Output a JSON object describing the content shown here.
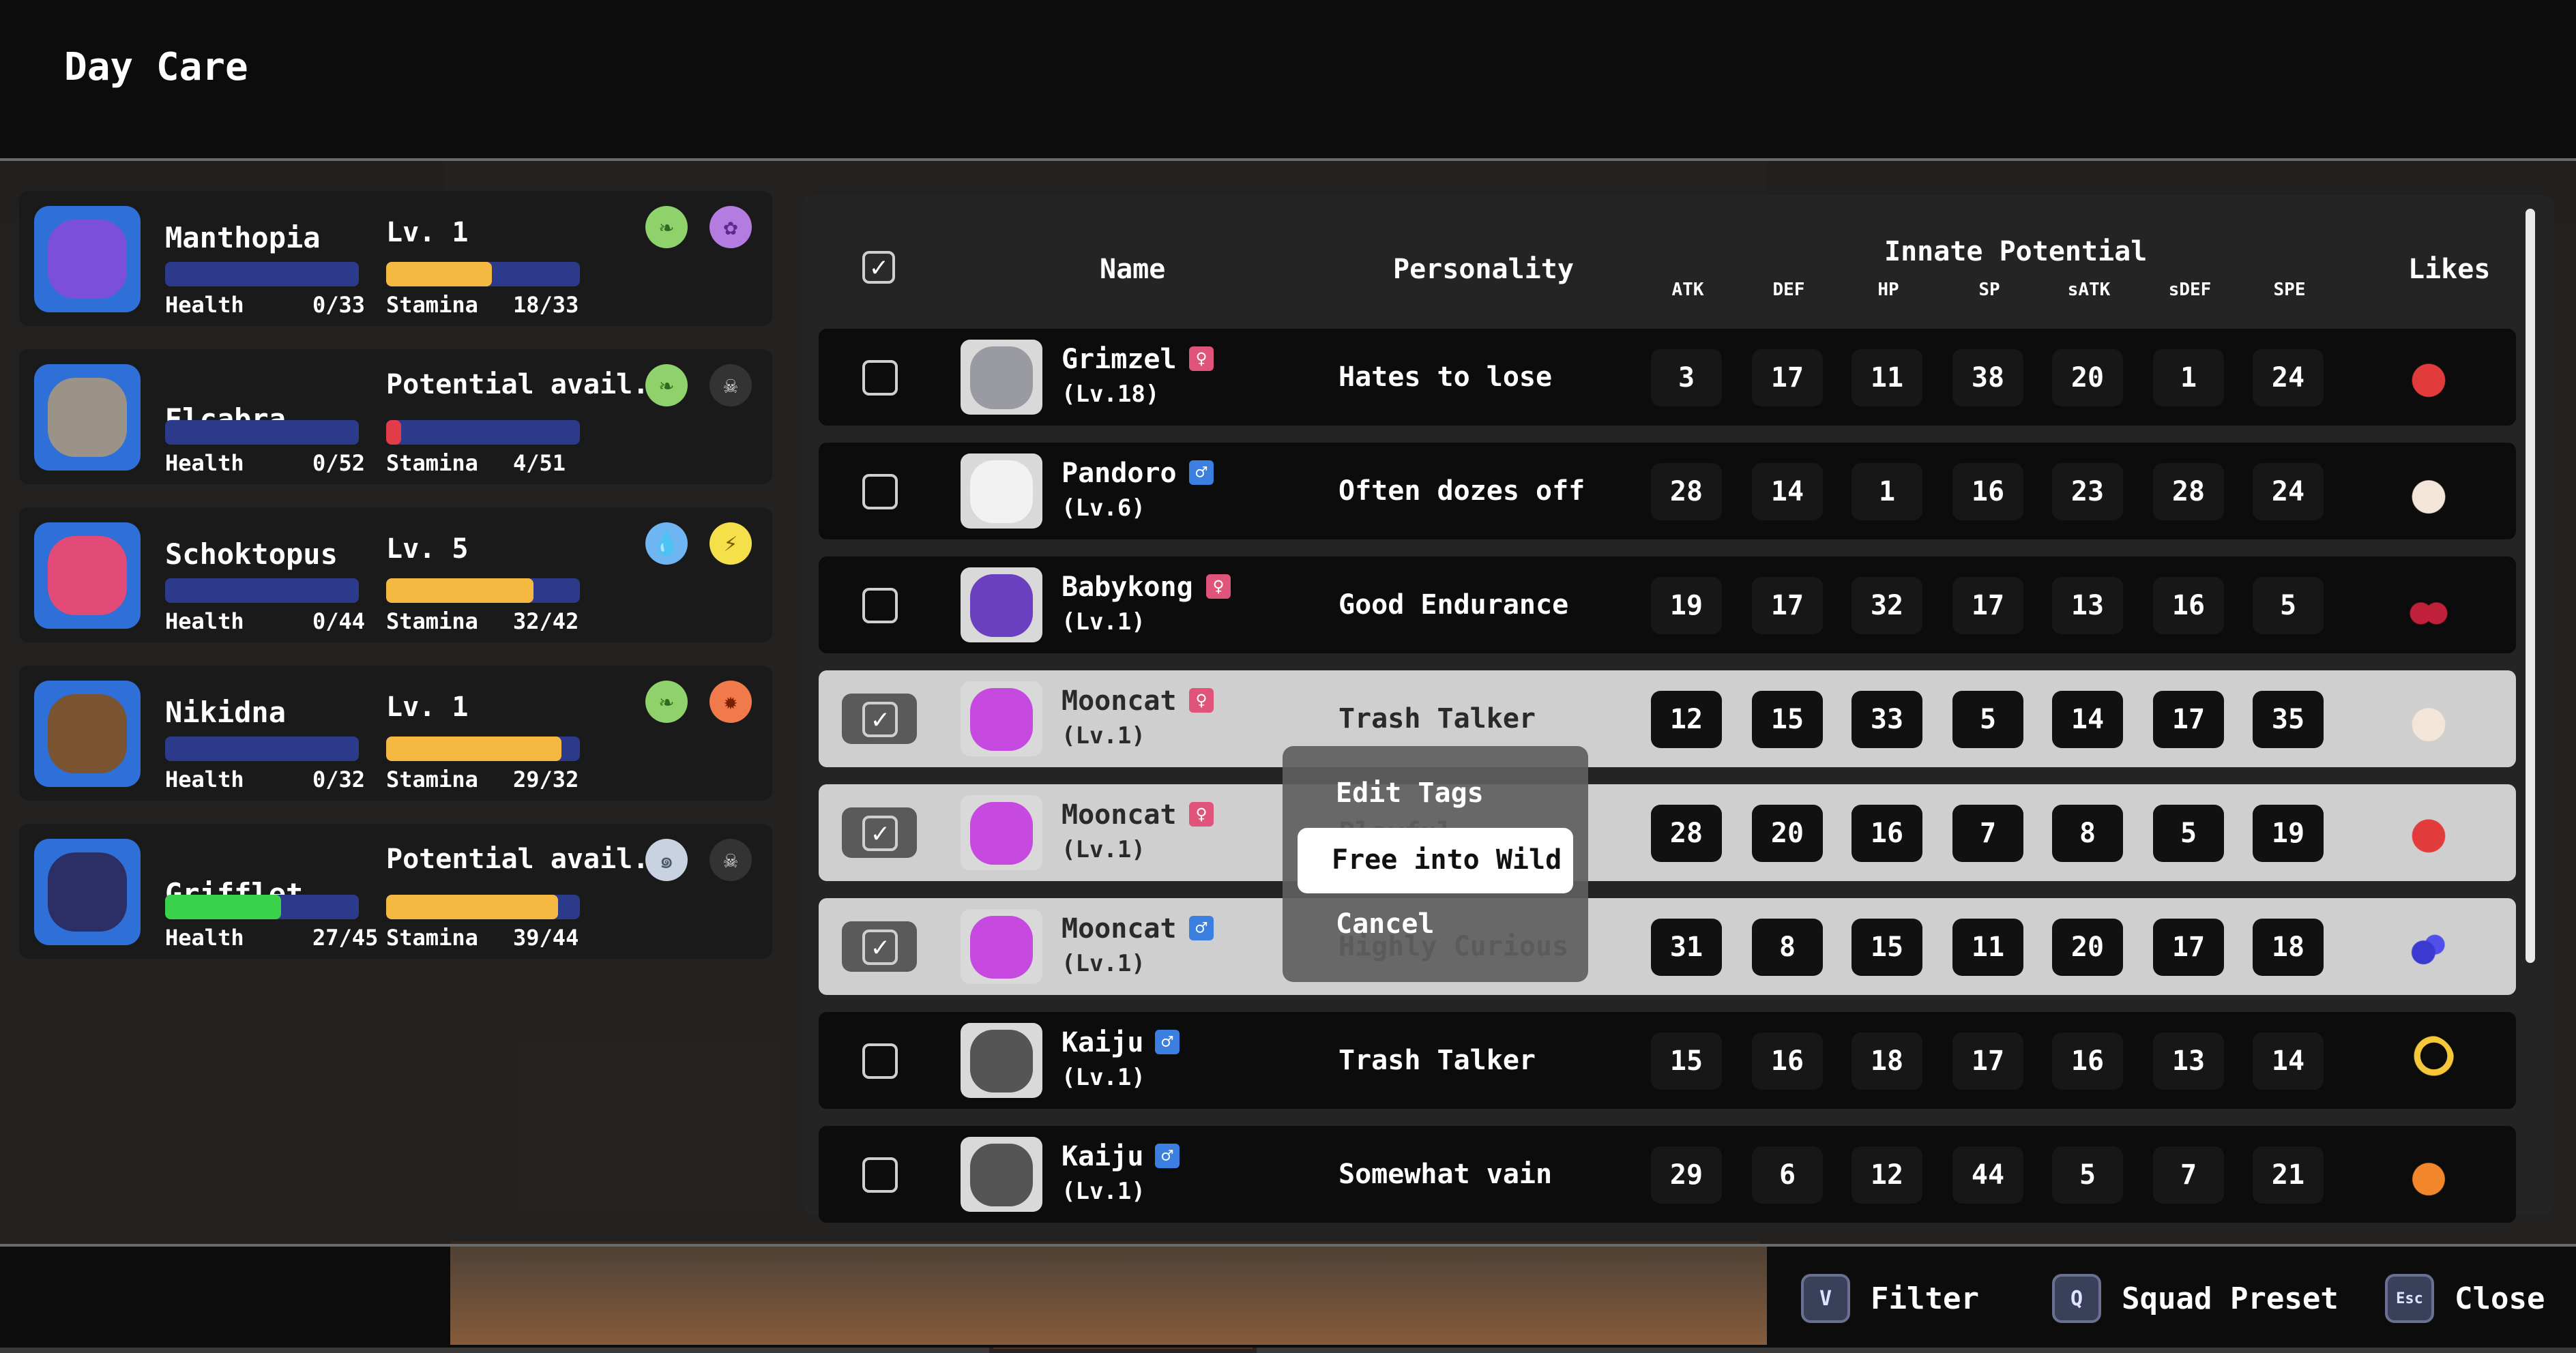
{
  "window": {
    "title": "Day Care"
  },
  "party": [
    {
      "name": "Manthopia",
      "level_label": "Lv. 1",
      "potential_label": "",
      "health_label": "Health",
      "health_value": "0/33",
      "health_fraction": 0.0,
      "stamina_label": "Stamina",
      "stamina_value": "18/33",
      "stamina_fraction": 0.545,
      "types": [
        "leaf-icon",
        "poison-icon"
      ],
      "color": "#7b4fd8"
    },
    {
      "name": "Elcabra",
      "level_label": "",
      "potential_label": "Potential avail.",
      "health_label": "Health",
      "health_value": "0/52",
      "health_fraction": 0.0,
      "stamina_label": "Stamina",
      "stamina_value": "4/51",
      "stamina_fraction": 0.078,
      "types": [
        "leaf-icon",
        "skull-icon"
      ],
      "color": "#9b9388"
    },
    {
      "name": "Schoktopus",
      "level_label": "Lv. 5",
      "potential_label": "",
      "health_label": "Health",
      "health_value": "0/44",
      "health_fraction": 0.0,
      "stamina_label": "Stamina",
      "stamina_value": "32/42",
      "stamina_fraction": 0.762,
      "types": [
        "water-icon",
        "lightning-icon"
      ],
      "color": "#e24a78"
    },
    {
      "name": "Nikidna",
      "level_label": "Lv. 1",
      "potential_label": "",
      "health_label": "Health",
      "health_value": "0/32",
      "health_fraction": 0.0,
      "stamina_label": "Stamina",
      "stamina_value": "29/32",
      "stamina_fraction": 0.906,
      "types": [
        "leaf-icon",
        "fire-icon"
      ],
      "color": "#7a5430"
    },
    {
      "name": "Grifflet",
      "level_label": "",
      "potential_label": "Potential avail.",
      "health_label": "Health",
      "health_value": "27/45",
      "health_fraction": 0.6,
      "stamina_label": "Stamina",
      "stamina_value": "39/44",
      "stamina_fraction": 0.886,
      "types": [
        "wind-icon",
        "skull-icon"
      ],
      "color": "#2b2f66"
    }
  ],
  "table": {
    "headers": {
      "name": "Name",
      "personality": "Personality",
      "potential": "Innate Potential",
      "likes": "Likes"
    },
    "stat_headers": [
      "ATK",
      "DEF",
      "HP",
      "SP",
      "sATK",
      "sDEF",
      "SPE"
    ],
    "select_all_checked": true,
    "rows": [
      {
        "name": "Grimzel",
        "level": "(Lv.18)",
        "gender": "female",
        "gender_symbol": "♀",
        "personality": "Hates to lose",
        "stats": [
          "3",
          "17",
          "11",
          "38",
          "20",
          "1",
          "24"
        ],
        "like": "strawberry-icon",
        "checked": false,
        "color": "#9a9aa2"
      },
      {
        "name": "Pandoro",
        "level": "(Lv.6)",
        "gender": "male",
        "gender_symbol": "♂",
        "personality": "Often dozes off",
        "stats": [
          "28",
          "14",
          "1",
          "16",
          "23",
          "28",
          "24"
        ],
        "like": "garlic-icon",
        "checked": false,
        "color": "#f2f2f2"
      },
      {
        "name": "Babykong",
        "level": "(Lv.1)",
        "gender": "female",
        "gender_symbol": "♀",
        "personality": "Good Endurance",
        "stats": [
          "19",
          "17",
          "32",
          "17",
          "13",
          "16",
          "5"
        ],
        "like": "cherries-icon",
        "checked": false,
        "color": "#6a3fc0"
      },
      {
        "name": "Mooncat",
        "level": "(Lv.1)",
        "gender": "female",
        "gender_symbol": "♀",
        "personality": "Trash Talker",
        "stats": [
          "12",
          "15",
          "33",
          "5",
          "14",
          "17",
          "35"
        ],
        "like": "garlic-icon",
        "checked": true,
        "color": "#c64adf"
      },
      {
        "name": "Mooncat",
        "level": "(Lv.1)",
        "gender": "female",
        "gender_symbol": "♀",
        "personality": "Playful",
        "stats": [
          "28",
          "20",
          "16",
          "7",
          "8",
          "5",
          "19"
        ],
        "like": "strawberry-icon",
        "checked": true,
        "color": "#c64adf"
      },
      {
        "name": "Mooncat",
        "level": "(Lv.1)",
        "gender": "male",
        "gender_symbol": "♂",
        "personality": "Highly Curious",
        "stats": [
          "31",
          "8",
          "15",
          "11",
          "20",
          "17",
          "18"
        ],
        "like": "blueberries-icon",
        "checked": true,
        "color": "#c64adf"
      },
      {
        "name": "Kaiju",
        "level": "(Lv.1)",
        "gender": "male",
        "gender_symbol": "♂",
        "personality": "Trash Talker",
        "stats": [
          "15",
          "16",
          "18",
          "17",
          "16",
          "13",
          "14"
        ],
        "like": "banana-icon",
        "checked": false,
        "color": "#555"
      },
      {
        "name": "Kaiju",
        "level": "(Lv.1)",
        "gender": "male",
        "gender_symbol": "♂",
        "personality": "Somewhat vain",
        "stats": [
          "29",
          "6",
          "12",
          "44",
          "5",
          "7",
          "21"
        ],
        "like": "orange-icon",
        "checked": false,
        "color": "#555"
      }
    ]
  },
  "context_menu": {
    "items": [
      "Edit Tags",
      "Free into Wild",
      "Cancel"
    ],
    "highlighted_index": 1
  },
  "bottom_bar": [
    {
      "key": "V",
      "label": "Filter",
      "icon": "v-key-icon"
    },
    {
      "key": "Q",
      "label": "Squad Preset",
      "icon": "q-key-icon"
    },
    {
      "key": "Esc",
      "label": "Close",
      "icon": "esc-key-icon"
    }
  ],
  "colors": {
    "health": "#3ad24a",
    "stamina": "#f5b840",
    "stamina_low": "#e23b4a",
    "bar_bg": "#2c3a8c"
  }
}
